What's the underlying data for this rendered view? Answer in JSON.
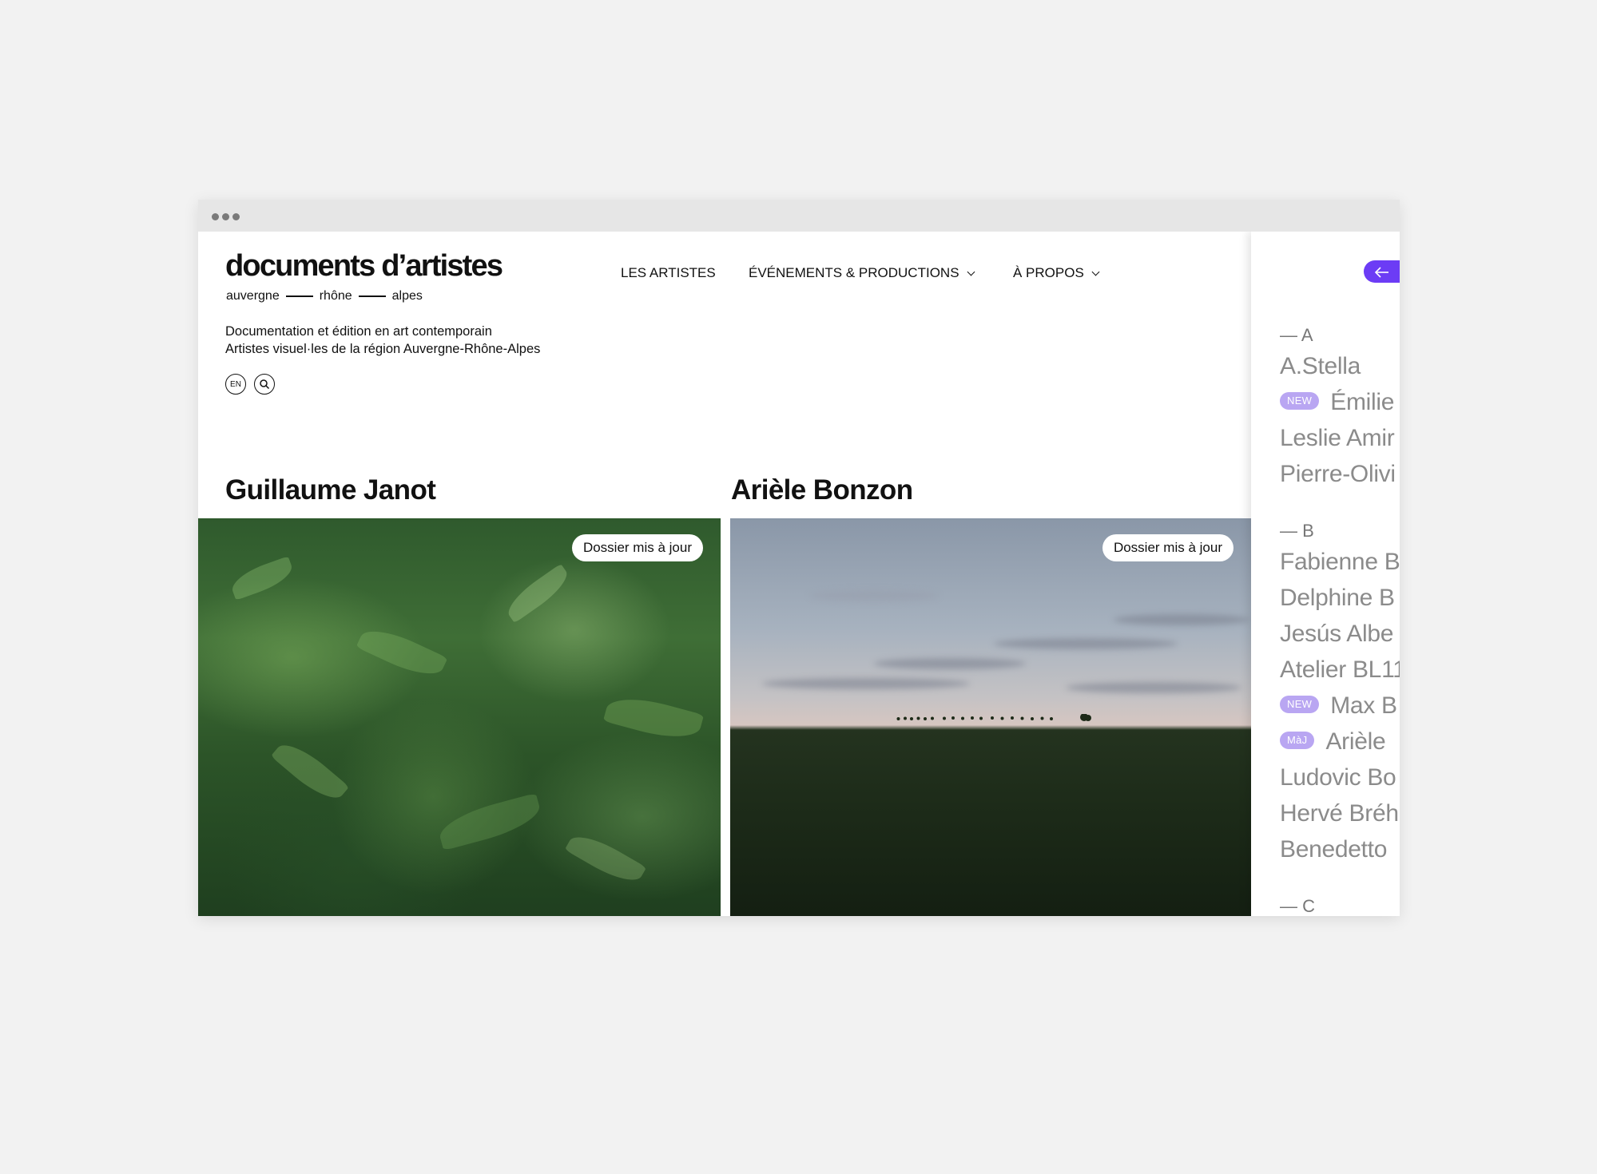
{
  "site": {
    "logo_text": "documents d’artistes",
    "logo_sub": [
      "auvergne",
      "rhône",
      "alpes"
    ],
    "tagline_line1": "Documentation et édition en art contemporain",
    "tagline_line2": "Artistes visuel·les de la région Auvergne-Rhône-Alpes",
    "lang_button": "EN"
  },
  "nav": [
    {
      "label": "LES ARTISTES",
      "has_dropdown": false
    },
    {
      "label": "ÉVÉNEMENTS & PRODUCTIONS",
      "has_dropdown": true
    },
    {
      "label": "À PROPOS",
      "has_dropdown": true
    }
  ],
  "cards": [
    {
      "artist": "Guillaume Janot",
      "badge": "Dossier mis à jour"
    },
    {
      "artist": "Arièle Bonzon",
      "badge": "Dossier mis à jour"
    }
  ],
  "sidebar": {
    "back_icon": "arrow-left-icon",
    "groups": [
      {
        "letter": "— A",
        "items": [
          {
            "name": "A.Stella",
            "tag": ""
          },
          {
            "name": "Émilie",
            "tag": "NEW"
          },
          {
            "name": "Leslie Amir",
            "tag": ""
          },
          {
            "name": "Pierre-Olivi",
            "tag": ""
          }
        ]
      },
      {
        "letter": "— B",
        "items": [
          {
            "name": "Fabienne B",
            "tag": ""
          },
          {
            "name": "Delphine B",
            "tag": ""
          },
          {
            "name": "Jesús Albe",
            "tag": ""
          },
          {
            "name": "Atelier BL11",
            "tag": ""
          },
          {
            "name": "Max B",
            "tag": "NEW"
          },
          {
            "name": "Arièle",
            "tag": "MàJ"
          },
          {
            "name": "Ludovic Bo",
            "tag": ""
          },
          {
            "name": "Hervé Bréh",
            "tag": ""
          },
          {
            "name": "Benedetto",
            "tag": ""
          }
        ]
      },
      {
        "letter": "— C",
        "items": []
      }
    ]
  },
  "colors": {
    "accent": "#6c3cf5",
    "tag": "#b9a6f2",
    "sidebar_text": "#8b8b8b"
  }
}
